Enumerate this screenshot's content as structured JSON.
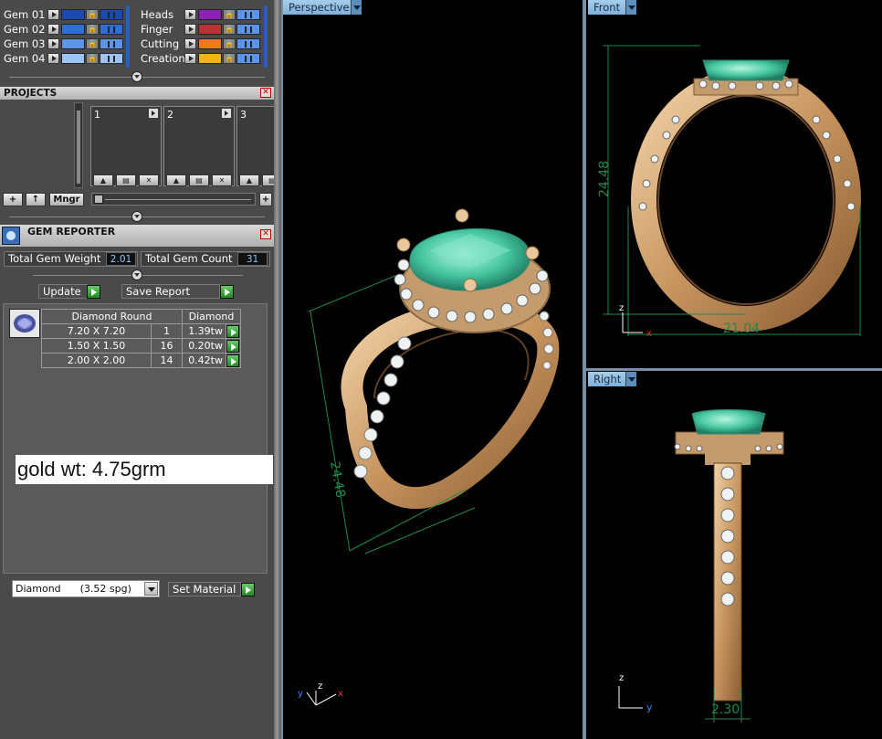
{
  "gems": {
    "left": [
      {
        "label": "Gem 01",
        "color": "#1c49b0"
      },
      {
        "label": "Gem 02",
        "color": "#2f6fd4"
      },
      {
        "label": "Gem 03",
        "color": "#5c95e8"
      },
      {
        "label": "Gem 04",
        "color": "#9cc4f4"
      }
    ],
    "right": [
      {
        "label": "Heads",
        "color": "#8a22b5"
      },
      {
        "label": "Finger",
        "color": "#b83434"
      },
      {
        "label": "Cutting",
        "color": "#ef7a17"
      },
      {
        "label": "Creation",
        "color": "#f3b31c"
      }
    ]
  },
  "projects": {
    "title": "PROJECTS",
    "slots": [
      "1",
      "2",
      "3"
    ],
    "mngr_label": "Mngr"
  },
  "gem_reporter": {
    "title": "GEM REPORTER",
    "total_weight_label": "Total Gem Weight",
    "total_weight_value": "2.01",
    "total_count_label": "Total Gem Count",
    "total_count_value": "31",
    "update_label": "Update",
    "save_label": "Save Report",
    "table_headers": [
      "Diamond Round",
      "Diamond"
    ],
    "rows": [
      {
        "size": "7.20 X 7.20",
        "qty": "1",
        "wt": "1.39tw"
      },
      {
        "size": "1.50 X 1.50",
        "qty": "16",
        "wt": "0.20tw"
      },
      {
        "size": "2.00 X 2.00",
        "qty": "14",
        "wt": "0.42tw"
      }
    ],
    "note": "gold wt: 4.75grm",
    "material_value": "Diamond      (3.52 spg)",
    "set_material_label": "Set Material"
  },
  "viewports": {
    "perspective": {
      "label": "Perspective",
      "dimension": "24.48",
      "axes": [
        "y",
        "z",
        "x"
      ]
    },
    "front": {
      "label": "Front",
      "height_dim": "24.48",
      "width_dim": "21.04",
      "axes": [
        "z",
        "x"
      ]
    },
    "right": {
      "label": "Right",
      "width_dim": "2.30",
      "axes": [
        "z",
        "y"
      ]
    }
  },
  "colors": {
    "gold": "#d3a06c",
    "gem": "#4ec9a4",
    "dimension_line": "#1d8a4a",
    "viewport_tab": "#8fbde3"
  }
}
